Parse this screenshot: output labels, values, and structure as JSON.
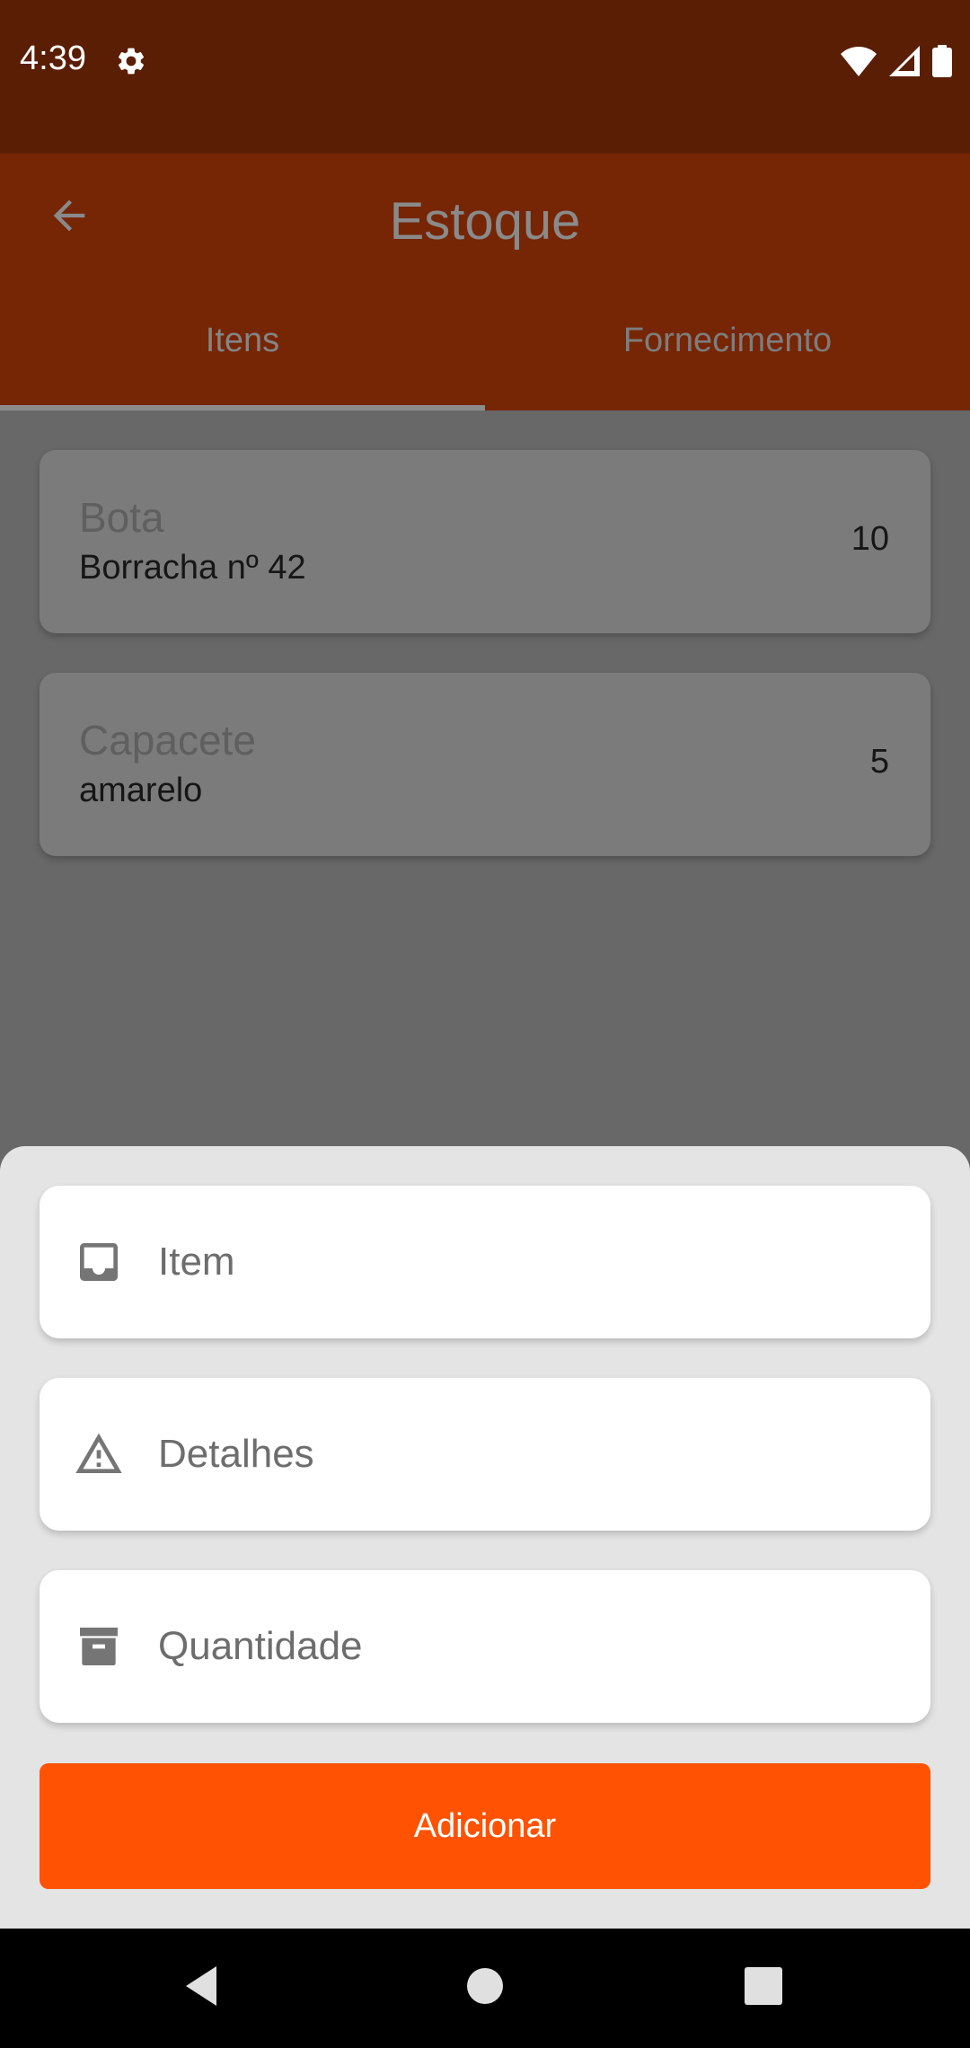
{
  "status_bar": {
    "time": "4:39"
  },
  "app_bar": {
    "title": "Estoque",
    "tabs": [
      {
        "label": "Itens",
        "active": true
      },
      {
        "label": "Fornecimento",
        "active": false
      }
    ]
  },
  "items": [
    {
      "name": "Bota",
      "detail": "Borracha nº 42",
      "quantity": "10"
    },
    {
      "name": "Capacete",
      "detail": "amarelo",
      "quantity": "5"
    }
  ],
  "form": {
    "item_placeholder": "Item",
    "details_placeholder": "Detalhes",
    "quantity_placeholder": "Quantidade",
    "submit_label": "Adicionar"
  },
  "colors": {
    "status_bar": "#5a1e05",
    "app_bar": "#762505",
    "accent": "#ff5303",
    "scrim": "#686868",
    "sheet": "#e4e4e4"
  },
  "icons": {
    "status": [
      "gear-icon",
      "wifi-icon",
      "signal-icon",
      "battery-icon"
    ],
    "app_bar": [
      "back-arrow-icon"
    ],
    "fields": [
      "inbox-icon",
      "warning-icon",
      "archive-icon"
    ],
    "nav": [
      "nav-back-icon",
      "nav-home-icon",
      "nav-recents-icon"
    ]
  }
}
